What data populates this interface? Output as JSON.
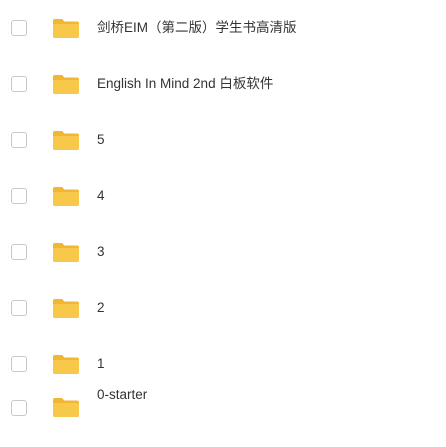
{
  "files": [
    {
      "name": "剑桥EIM（第二版）学生书高清版",
      "icon": "folder-icon"
    },
    {
      "name": "English In Mind 2nd 白板软件",
      "icon": "folder-icon"
    },
    {
      "name": "5",
      "icon": "folder-icon"
    },
    {
      "name": "4",
      "icon": "folder-icon"
    },
    {
      "name": "3",
      "icon": "folder-icon"
    },
    {
      "name": "2",
      "icon": "folder-icon"
    },
    {
      "name": "1",
      "icon": "folder-icon"
    },
    {
      "name": "0-starter",
      "icon": "folder-icon"
    }
  ],
  "colors": {
    "folder_fill": "#F7C84A",
    "folder_tab": "#F2B632",
    "text": "#333333",
    "checkbox_border": "#C8C8C8"
  }
}
